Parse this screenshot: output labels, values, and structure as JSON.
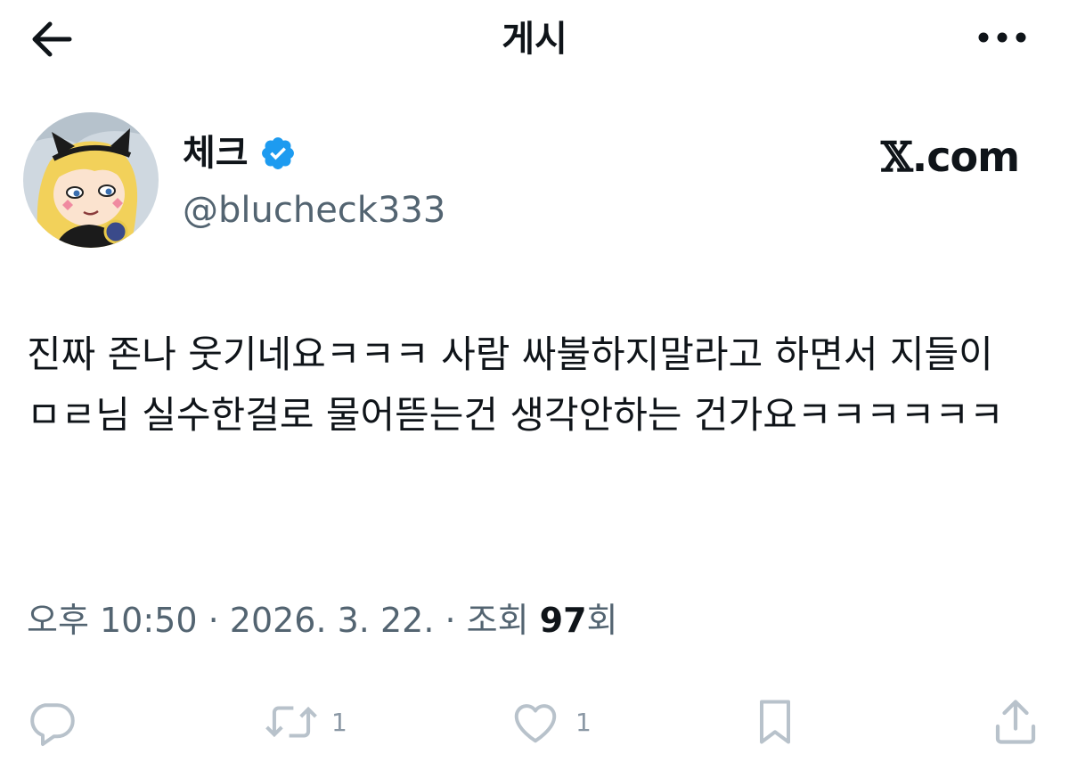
{
  "header": {
    "back_icon": "arrow-left-icon",
    "title": "게시",
    "more_icon": "more-dots-icon"
  },
  "author": {
    "display_name": "체크",
    "verified_icon": "verified-badge-icon",
    "verified_color": "#1d9bf0",
    "handle": "@blucheck333"
  },
  "source": {
    "prefix": "𝕏",
    "suffix": ".com"
  },
  "tweet": {
    "text": "진짜 존나 웃기네요ㅋㅋㅋ 사람 싸불하지말라고 하면서 지들이 ㅁㄹ님 실수한걸로 물어뜯는건 생각안하는 건가요ㅋㅋㅋㅋㅋㅋ"
  },
  "meta": {
    "time": "오후 10:50",
    "sep1": " · ",
    "date": "2026. 3. 22.",
    "sep2": " · ",
    "views_label": "조회 ",
    "views_count": "97",
    "views_suffix": "회"
  },
  "actions": {
    "reply": {
      "icon": "reply-icon"
    },
    "repost": {
      "icon": "repost-icon",
      "count": "1"
    },
    "like": {
      "icon": "heart-icon",
      "count": "1"
    },
    "bookmark": {
      "icon": "bookmark-icon"
    },
    "share": {
      "icon": "share-icon"
    }
  },
  "colors": {
    "text": "#0f1419",
    "secondary": "#536471",
    "action_icons": "#b8c2cb"
  }
}
